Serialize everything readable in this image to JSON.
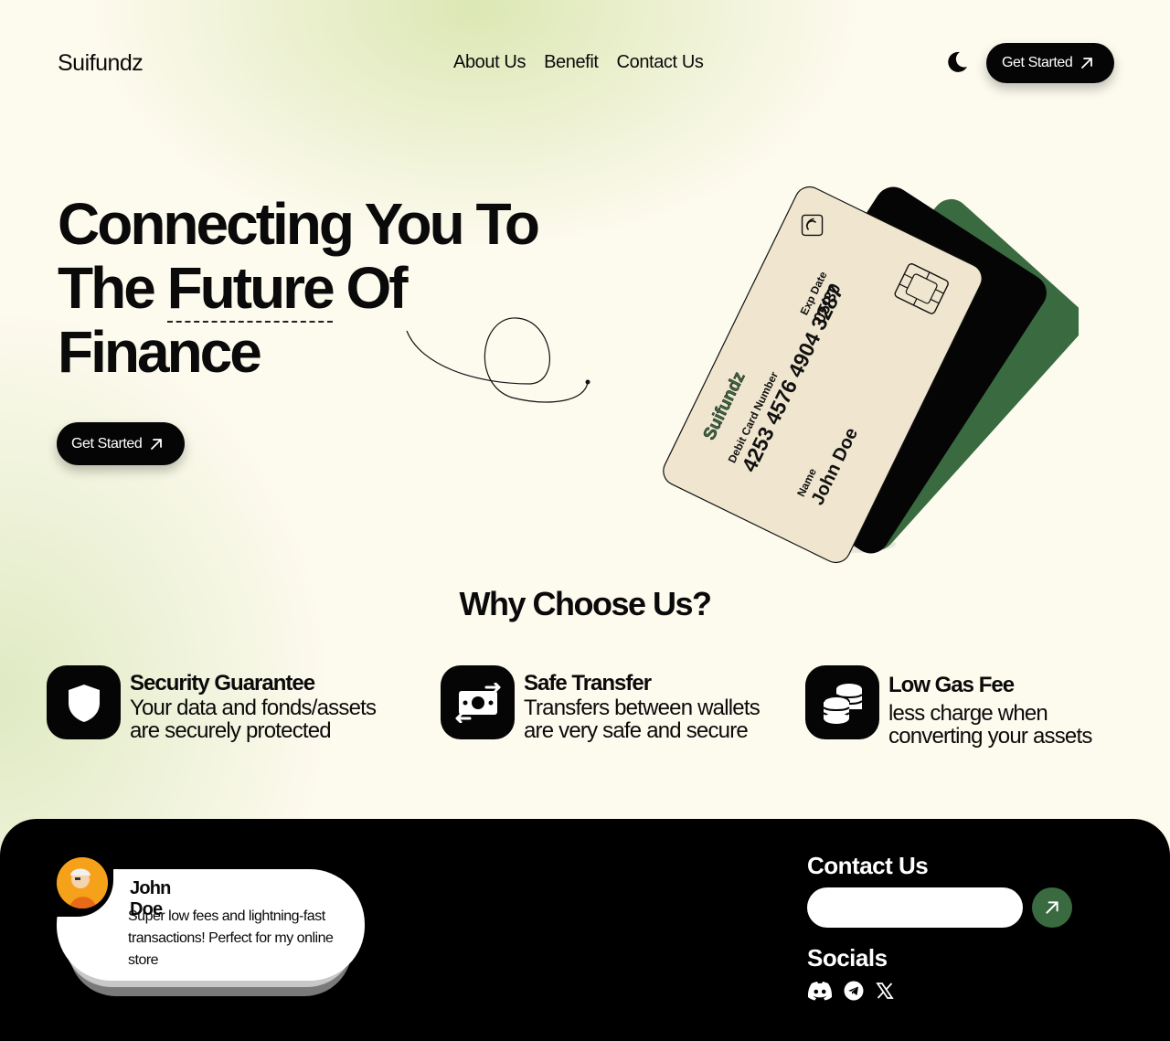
{
  "header": {
    "brand": "Suifundz",
    "nav": [
      "About Us",
      "Benefit",
      "Contact Us"
    ],
    "theme_toggle_icon": "moon-icon",
    "cta_label": "Get Started"
  },
  "hero": {
    "title_line1": "Connecting You To",
    "title_line2a": "The ",
    "title_line2b": "Future",
    "title_line2c": " Of",
    "title_line3": "Finance",
    "cta_label": "Get Started"
  },
  "card": {
    "brand": "Suifundz",
    "number_label": "Debit Card Number",
    "number": "4253 4576 4904 3287",
    "exp_label": "Exp Date",
    "exp": "05/30",
    "name_label": "Name",
    "name": "John Doe",
    "colors": {
      "front": "#f0e6cf",
      "middle": "#050505",
      "back": "#3a6a3f",
      "brand": "#3a6a3f"
    }
  },
  "why": {
    "title": "Why Choose  Us?",
    "features": [
      {
        "icon": "shield-icon",
        "title": "Security  Guarantee",
        "desc1": "Your data and fonds/assets",
        "desc2": "are securely protected"
      },
      {
        "icon": "money-transfer-icon",
        "title": "Safe Transfer",
        "desc1": "Transfers between wallets",
        "desc2": "are very safe and secure"
      },
      {
        "icon": "coins-icon",
        "title": "Low Gas Fee",
        "desc1": "less charge when",
        "desc2": "converting your assets"
      }
    ]
  },
  "footer": {
    "review": {
      "name": "John Doe",
      "text": "Super low fees and lightning-fast transactions! Perfect for my online store"
    },
    "contact_title": "Contact Us",
    "contact_value": "",
    "socials_title": "Socials",
    "socials": [
      "discord-icon",
      "telegram-icon",
      "x-icon"
    ]
  },
  "colors": {
    "accent_green": "#3a6a3f",
    "background": "#fdfaee",
    "dark": "#050505"
  }
}
